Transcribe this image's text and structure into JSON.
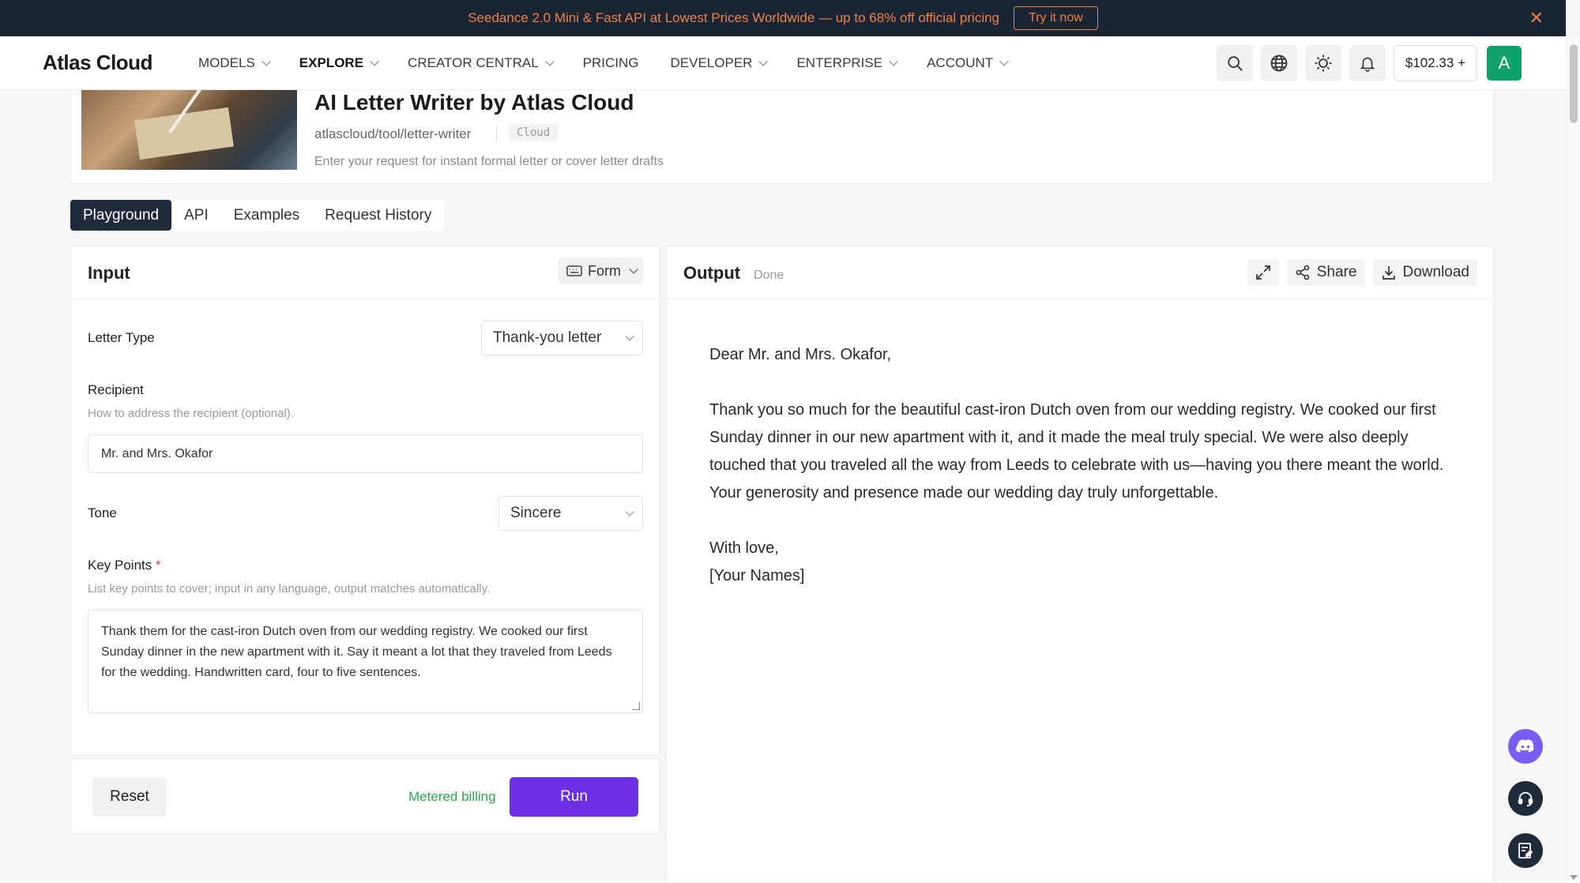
{
  "banner": {
    "text": "Seedance 2.0 Mini & Fast API at Lowest Prices Worldwide — up to 68% off official pricing",
    "cta": "Try it now",
    "close_icon": "close-icon"
  },
  "nav": {
    "logo": "Atlas Cloud",
    "items": [
      {
        "label": "MODELS",
        "dropdown": true
      },
      {
        "label": "EXPLORE",
        "dropdown": true,
        "active": true
      },
      {
        "label": "CREATOR CENTRAL",
        "dropdown": true
      },
      {
        "label": "PRICING",
        "dropdown": false
      },
      {
        "label": "DEVELOPER",
        "dropdown": true
      },
      {
        "label": "ENTERPRISE",
        "dropdown": true
      },
      {
        "label": "ACCOUNT",
        "dropdown": true
      }
    ],
    "icons": [
      "search-icon",
      "globe-icon",
      "sun-icon",
      "bell-icon"
    ],
    "balance": "$102.33 +",
    "avatar_letter": "A"
  },
  "tool": {
    "title": "AI Letter Writer by Atlas Cloud",
    "path": "atlascloud/tool/letter-writer",
    "badge": "Cloud",
    "description": "Enter your request for instant formal letter or cover letter drafts"
  },
  "tabs": [
    {
      "label": "Playground",
      "active": true
    },
    {
      "label": "API"
    },
    {
      "label": "Examples"
    },
    {
      "label": "Request History"
    }
  ],
  "input": {
    "title": "Input",
    "mode": "Form",
    "letter_type": {
      "label": "Letter Type",
      "value": "Thank-you letter"
    },
    "recipient": {
      "label": "Recipient",
      "help": "How to address the recipient (optional).",
      "value": "Mr. and Mrs. Okafor"
    },
    "tone": {
      "label": "Tone",
      "value": "Sincere"
    },
    "key_points": {
      "label": "Key Points",
      "required_mark": "*",
      "help": "List key points to cover; input in any language, output matches automatically.",
      "value": "Thank them for the cast-iron Dutch oven from our wedding registry. We cooked our first Sunday dinner in the new apartment with it. Say it meant a lot that they traveled from Leeds for the wedding. Handwritten card, four to five sentences."
    },
    "reset": "Reset",
    "billing": "Metered billing",
    "run": "Run"
  },
  "output": {
    "title": "Output",
    "status": "Done",
    "share": "Share",
    "download": "Download",
    "letter": {
      "greeting": "Dear Mr. and Mrs. Okafor,",
      "body": "Thank you so much for the beautiful cast-iron Dutch oven from our wedding registry. We cooked our first Sunday dinner in our new apartment with it, and it made the meal truly special. We were also deeply touched that you traveled all the way from Leeds to celebrate with us—having you there meant the world. Your generosity and presence made our wedding day truly unforgettable.",
      "closing": "With love,",
      "signature": "[Your Names]"
    }
  },
  "colors": {
    "banner_bg": "#1b2433",
    "banner_accent": "#e8824a",
    "run_button": "#6b2fe6",
    "avatar": "#0fa36b",
    "billing_text": "#2aa84a",
    "discord": "#7b5cf0",
    "tab_active": "#1f2a3a"
  },
  "floating": [
    "discord-icon",
    "headset-icon",
    "feedback-icon"
  ]
}
